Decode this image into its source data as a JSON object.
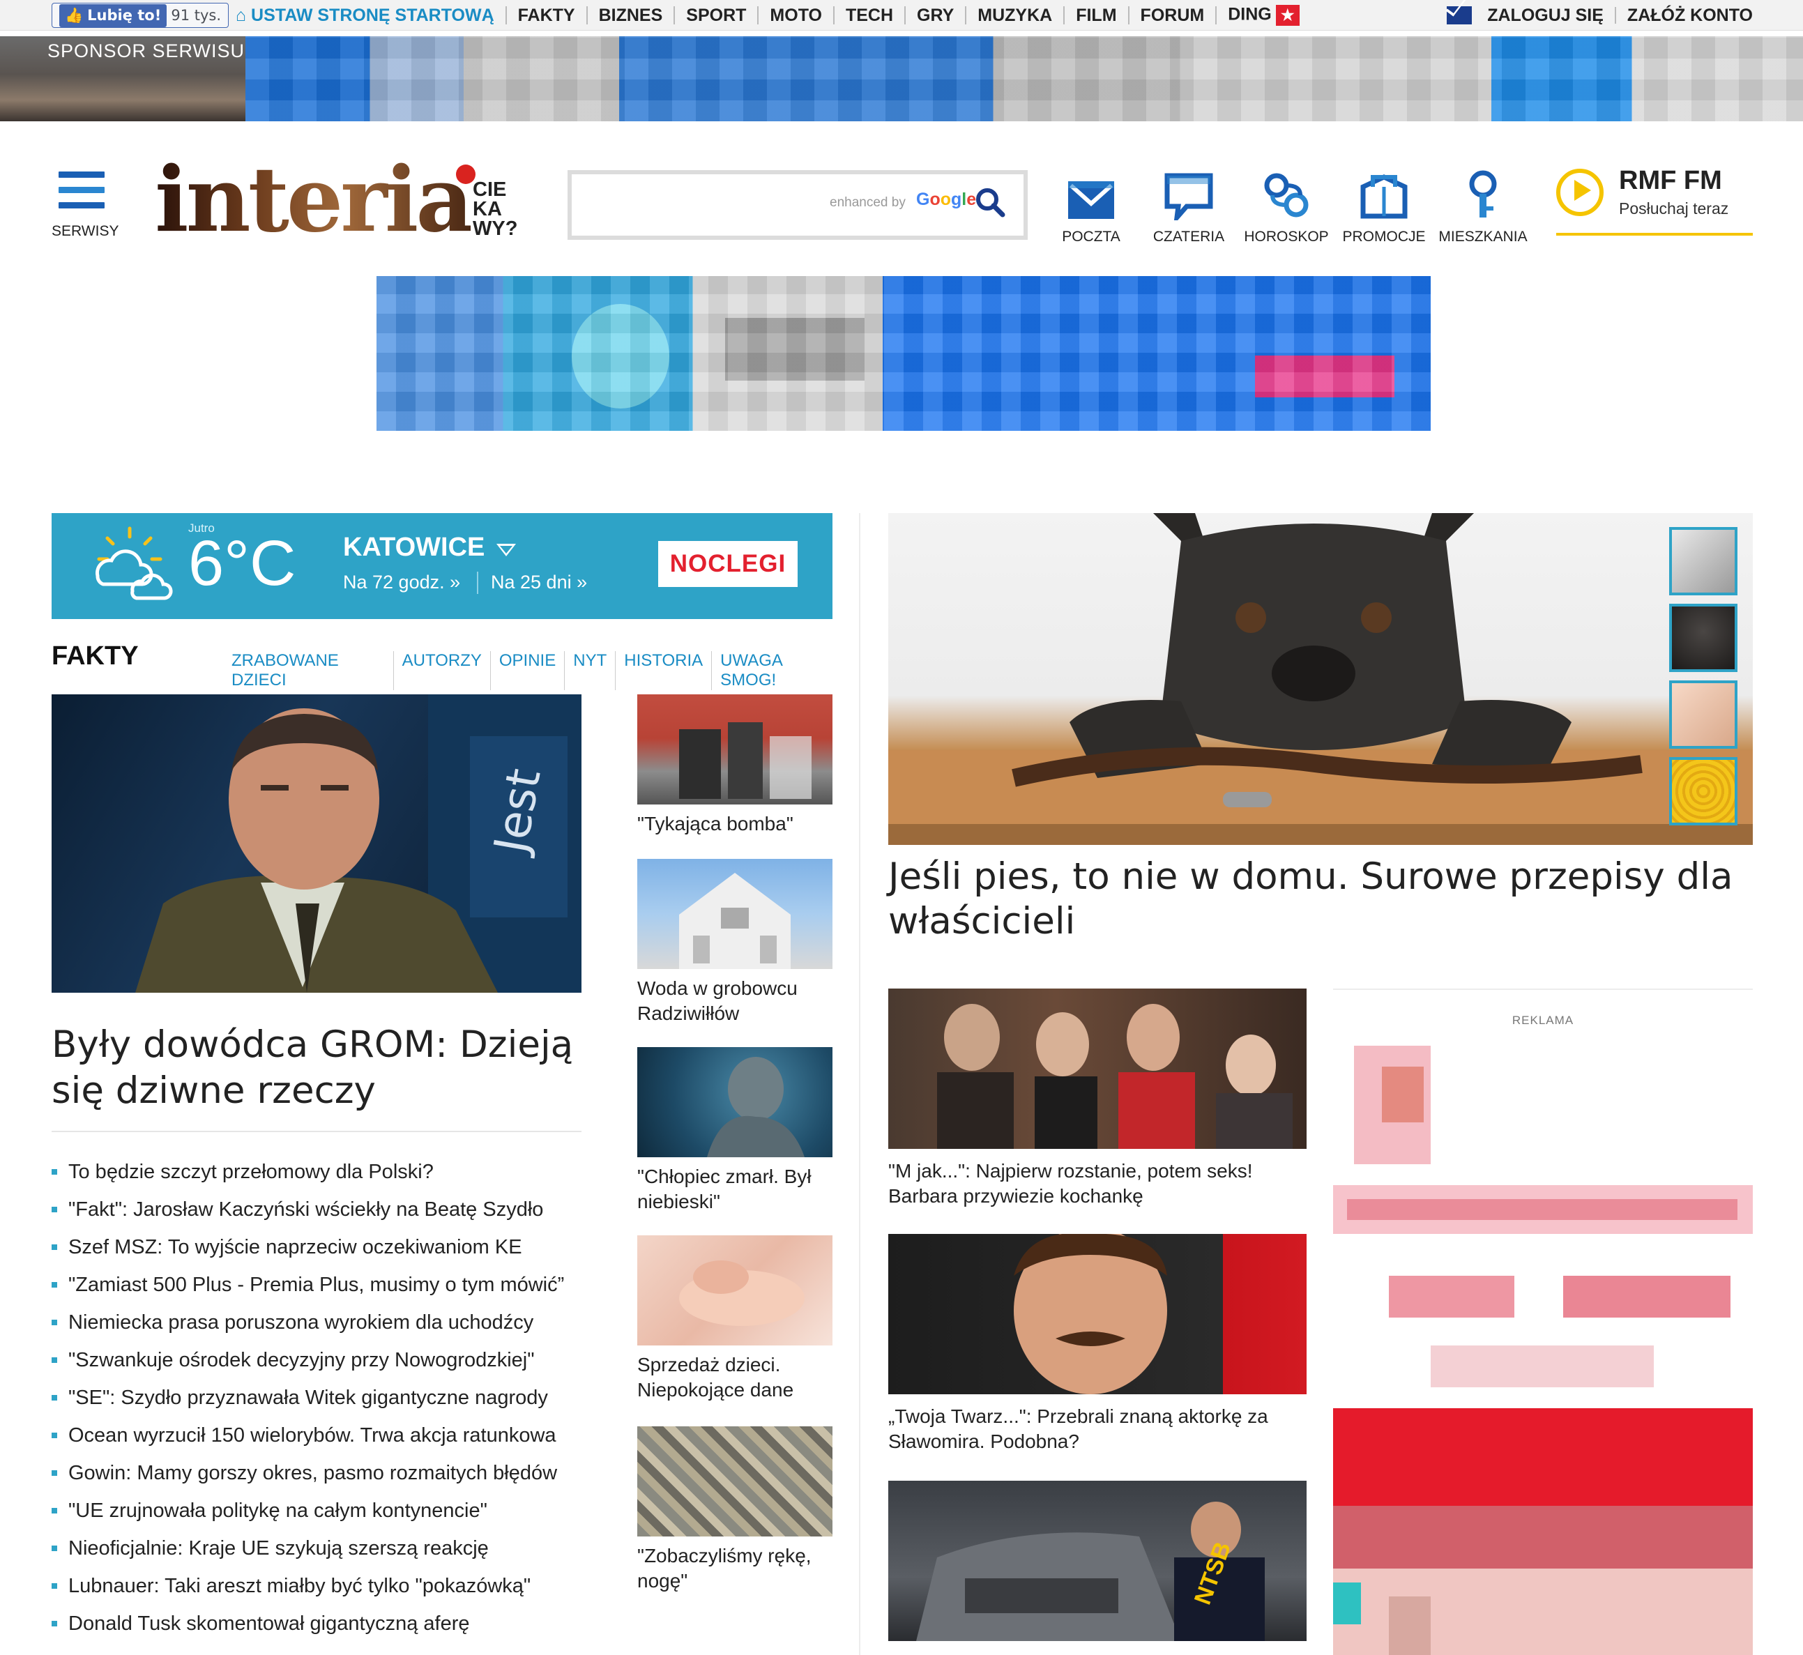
{
  "topbar": {
    "fb_like_label": "Lubię to!",
    "fb_like_count": "91 tys.",
    "nav": [
      "USTAW STRONĘ STARTOWĄ",
      "FAKTY",
      "BIZNES",
      "SPORT",
      "MOTO",
      "TECH",
      "GRY",
      "MUZYKA",
      "FILM",
      "FORUM",
      "DING"
    ],
    "login": "ZALOGUJ SIĘ",
    "register": "ZAŁÓŻ KONTO"
  },
  "sponsor": {
    "label": "SPONSOR SERWISU"
  },
  "header": {
    "menu_label": "SERWISY",
    "logo_text": "interia",
    "logo_tagline": [
      "CIE",
      "KA",
      "WY?"
    ],
    "search": {
      "enhanced": "enhanced by",
      "google": "Google",
      "value": ""
    },
    "services": [
      {
        "label": "POCZTA",
        "icon": "mail-icon"
      },
      {
        "label": "CZATERIA",
        "icon": "chat-icon"
      },
      {
        "label": "HOROSKOP",
        "icon": "horoscope-icon"
      },
      {
        "label": "PROMOCJE",
        "icon": "promo-bag-icon"
      },
      {
        "label": "MIESZKANIA",
        "icon": "key-icon"
      }
    ],
    "radio": {
      "title": "RMF FM",
      "subtitle": "Posłuchaj teraz"
    }
  },
  "weather": {
    "day": "Jutro",
    "temp": "6°C",
    "city": "KATOWICE",
    "forecast_72": "Na 72 godz. »",
    "forecast_25": "Na 25 dni »",
    "noclegi": "NOCLEGI"
  },
  "fakty": {
    "title": "FAKTY",
    "tabs": [
      "ZRABOWANE DZIECI",
      "AUTORZY",
      "OPINIE",
      "NYT",
      "HISTORIA",
      "UWAGA SMOG!"
    ],
    "main_headline": "Były dowódca GROM: Dzieją się dziwne rzeczy",
    "main_photo_text": "Jest",
    "list": [
      "To będzie szczyt przełomowy dla Polski?",
      "\"Fakt\": Jarosław Kaczyński wściekły na Beatę Szydło",
      "Szef MSZ: To wyjście naprzeciw oczekiwaniom KE",
      "\"Zamiast 500 Plus - Premia Plus, musimy o tym mówić”",
      "Niemiecka prasa poruszona wyrokiem dla uchodźcy",
      "\"Szwankuje ośrodek decyzyjny przy Nowogrodzkiej\"",
      "\"SE\": Szydło przyznawała Witek gigantyczne nagrody",
      "Ocean wyrzucił 150 wielorybów. Trwa akcja ratunkowa",
      "Gowin: Mamy gorszy okres, pasmo rozmaitych błędów",
      "\"UE zrujnowała politykę na całym kontynencie\"",
      "Nieoficjalnie: Kraje UE szykują szerszą reakcję",
      "Lubnauer: Taki areszt miałby być tylko \"pokazówką\"",
      "Donald Tusk skomentował gigantyczną aferę"
    ],
    "side": [
      "\"Tykająca bomba\"",
      "Woda w grobowcu Radziwiłłów",
      "\"Chłopiec zmarł. Był niebieski\"",
      "Sprzedaż dzieci. Niepokojące dane",
      "\"Zobaczyliśmy rękę, nogę\""
    ]
  },
  "right": {
    "dog_headline": "Jeśli pies, to nie w domu. Surowe przepisy dla właścicieli",
    "stories": [
      "\"M jak...\": Najpierw rozstanie, potem seks! Barbara przywiezie kochankę",
      "„Twoja Twarz...\": Przebrali znaną aktorkę za Sławomira. Podobna?"
    ],
    "third_story_photo_text": "NTSB",
    "ad_label": "REKLAMA"
  },
  "colors": {
    "accent": "#2ea3c7",
    "link": "#1a8cc4",
    "brand_blue": "#1a5fb4",
    "red": "#e3202e",
    "rmf_yellow": "#f5c400"
  }
}
